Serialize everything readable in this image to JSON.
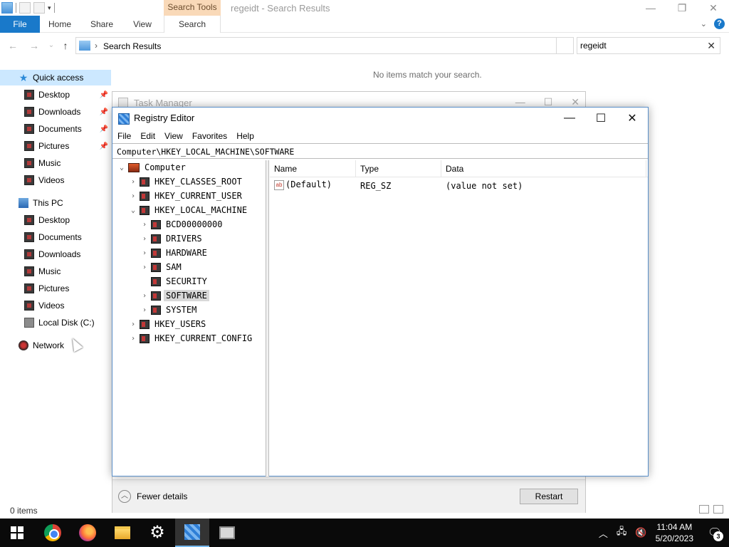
{
  "explorer": {
    "title": "regeidt - Search Results",
    "contextual_tab": "Search Tools",
    "ribbon_tabs": [
      "File",
      "Home",
      "Share",
      "View",
      "Search"
    ],
    "address": "Search Results",
    "search_value": "regeidt",
    "empty_message": "No items match your search.",
    "status": "0 items",
    "nav": {
      "quick_access": "Quick access",
      "quick_items": [
        "Desktop",
        "Downloads",
        "Documents",
        "Pictures",
        "Music",
        "Videos"
      ],
      "this_pc": "This PC",
      "pc_items": [
        "Desktop",
        "Documents",
        "Downloads",
        "Music",
        "Pictures",
        "Videos",
        "Local Disk (C:)"
      ],
      "network": "Network"
    }
  },
  "taskmgr": {
    "title": "Task Manager",
    "fewer_details": "Fewer details",
    "restart": "Restart"
  },
  "regedit": {
    "title": "Registry Editor",
    "menu": [
      "File",
      "Edit",
      "View",
      "Favorites",
      "Help"
    ],
    "address": "Computer\\HKEY_LOCAL_MACHINE\\SOFTWARE",
    "tree": {
      "root": "Computer",
      "hives": [
        "HKEY_CLASSES_ROOT",
        "HKEY_CURRENT_USER",
        "HKEY_LOCAL_MACHINE",
        "HKEY_USERS",
        "HKEY_CURRENT_CONFIG"
      ],
      "hklm_children": [
        "BCD00000000",
        "DRIVERS",
        "HARDWARE",
        "SAM",
        "SECURITY",
        "SOFTWARE",
        "SYSTEM"
      ],
      "selected": "SOFTWARE"
    },
    "columns": [
      "Name",
      "Type",
      "Data"
    ],
    "values": [
      {
        "name": "(Default)",
        "type": "REG_SZ",
        "data": "(value not set)"
      }
    ]
  },
  "taskbar": {
    "time": "11:04 AM",
    "date": "5/20/2023",
    "notifications": "3"
  }
}
